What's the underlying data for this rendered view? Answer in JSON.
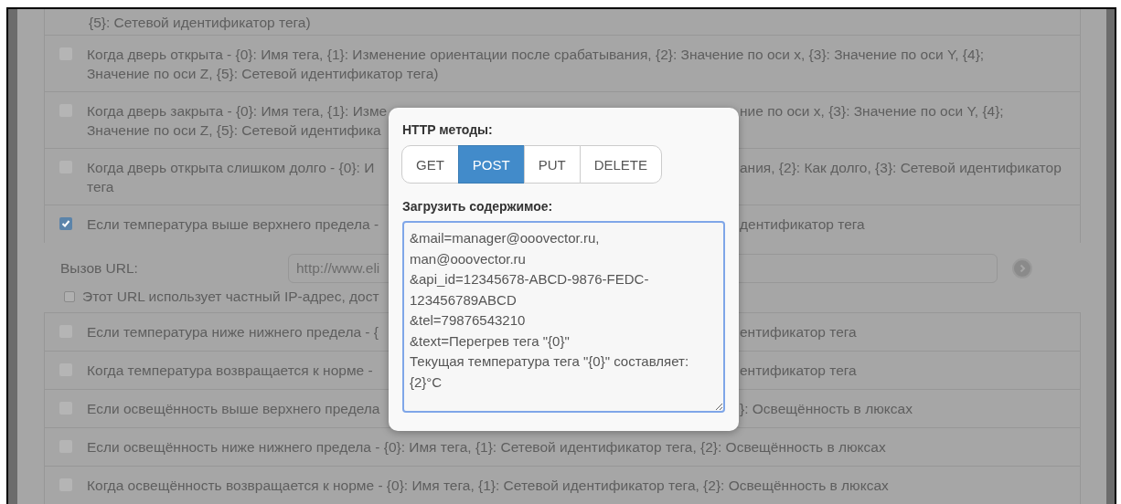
{
  "events_top": [
    {
      "kind": "tail",
      "lines": [
        {
          "left": "{5}: Сетевой идентификатор тега)"
        }
      ]
    },
    {
      "kind": "check",
      "checked": false,
      "text": "Когда дверь открыта - {0}: Имя тега, {1}: Изменение ориентации после срабатывания, {2}: Значение по оси x, {3}: Значение по оси Y, {4}; Значение по оси Z, {5}: Сетевой идентификатор тега)"
    },
    {
      "kind": "check",
      "checked": false,
      "lines": [
        {
          "left": "Когда дверь закрыта - {0}: Имя тега, {1}: Изме",
          "right": "ние по оси x, {3}: Значение по оси Y, {4};"
        },
        {
          "left": "Значение по оси Z, {5}: Сетевой идентифика"
        }
      ]
    },
    {
      "kind": "check",
      "checked": false,
      "lines": [
        {
          "left": "Когда дверь открыта слишком долго - {0}: И",
          "right": "ания, {2}: Как долго, {3}: Сетевой идентификатор"
        },
        {
          "left": "тега"
        }
      ]
    },
    {
      "kind": "check",
      "checked": true,
      "lines": [
        {
          "left": "Если температура выше верхнего предела -",
          "right": "дентификатор тега"
        }
      ]
    }
  ],
  "url": {
    "label": "Вызов URL:",
    "value": "http://www.eli",
    "private_ip": {
      "checked": false,
      "label": "Этот URL использует частный IP-адрес, дост"
    }
  },
  "events_bottom": [
    {
      "kind": "check",
      "checked": false,
      "lines": [
        {
          "left": "Если температура ниже нижнего предела - {",
          "right": "ентификатор тега"
        }
      ]
    },
    {
      "kind": "check",
      "checked": false,
      "lines": [
        {
          "left": "Когда температура возвращается к норме -",
          "right": "ентификатор тега"
        }
      ]
    },
    {
      "kind": "check",
      "checked": false,
      "lines": [
        {
          "left": "Если освещённость выше верхнего предела",
          "right": "}: Освещённость в люксах"
        }
      ]
    },
    {
      "kind": "check",
      "checked": false,
      "text": "Если освещённость ниже нижнего предела - {0}: Имя тега, {1}: Сетевой идентификатор тега, {2}: Освещённость в люксах"
    },
    {
      "kind": "check",
      "checked": false,
      "text": "Когда освещённость возвращается к норме - {0}: Имя тега, {1}: Сетевой идентификатор тега, {2}: Освещённость в люксах"
    }
  ],
  "popup": {
    "methods_label": "HTTP методы:",
    "methods": [
      {
        "label": "GET",
        "selected": false
      },
      {
        "label": "POST",
        "selected": true
      },
      {
        "label": "PUT",
        "selected": false
      },
      {
        "label": "DELETE",
        "selected": false
      }
    ],
    "payload_label": "Загрузить содержимое:",
    "payload": "&mail=manager@ooovector.ru,\nman@ooovector.ru\n&api_id=12345678-ABCD-9876-FEDC-\n123456789ABCD\n&tel=79876543210\n&text=Перегрев тега \"{0}\"\nТекущая температура тега \"{0}\" составляет:\n{2}°C"
  }
}
